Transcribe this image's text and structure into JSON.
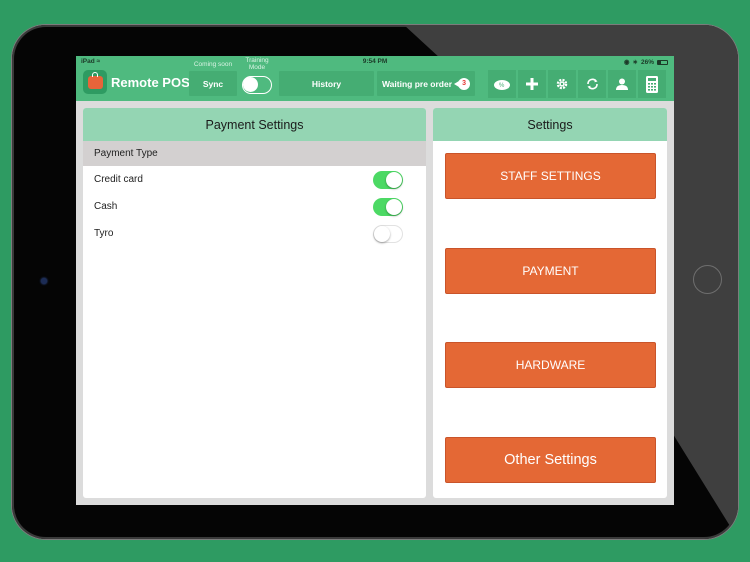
{
  "status_bar": {
    "device": "iPad",
    "wifi_icon": "wifi-icon",
    "time": "9:54 PM",
    "lock_icon": "orientation-lock-icon",
    "bluetooth_icon": "bluetooth-icon",
    "battery": "26%",
    "battery_level": 0.26
  },
  "topbar": {
    "app_title": "Remote POS",
    "logo_icon": "shopping-bag-icon",
    "sync": {
      "caption": "Coming soon",
      "label": "Sync"
    },
    "training_mode": {
      "caption": "Training Mode",
      "enabled": false
    },
    "history": {
      "label": "History"
    },
    "waiting_pre_order": {
      "label": "Waiting pre order",
      "count": "3"
    },
    "icons": [
      "discount-icon",
      "plus-icon",
      "gear-icon",
      "refresh-icon",
      "user-icon",
      "calculator-icon"
    ]
  },
  "payment_settings": {
    "title": "Payment Settings",
    "section": "Payment Type",
    "types": [
      {
        "label": "Credit card",
        "enabled": true
      },
      {
        "label": "Cash",
        "enabled": true
      },
      {
        "label": "Tyro",
        "enabled": false
      }
    ]
  },
  "settings": {
    "title": "Settings",
    "buttons": [
      {
        "label": "STAFF SETTINGS"
      },
      {
        "label": "PAYMENT"
      },
      {
        "label": "HARDWARE"
      },
      {
        "label": "Other Settings"
      }
    ]
  },
  "colors": {
    "background": "#2e9b62",
    "topbar": "#4fba7f",
    "panel_header": "#94d5b3",
    "accent_orange": "#e46835",
    "toggle_on": "#4cd964"
  }
}
